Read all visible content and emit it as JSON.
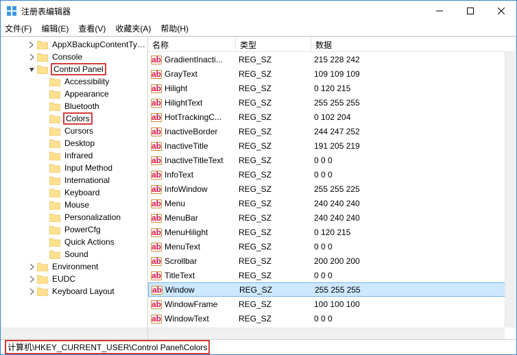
{
  "window": {
    "title": "注册表编辑器"
  },
  "menu": {
    "file": "文件(F)",
    "edit": "编辑(E)",
    "view": "查看(V)",
    "fav": "收藏夹(A)",
    "help": "帮助(H)"
  },
  "tree": [
    {
      "indent": 36,
      "tw": "r",
      "label": "AppXBackupContentType"
    },
    {
      "indent": 36,
      "tw": "r",
      "label": "Console"
    },
    {
      "indent": 36,
      "tw": "d",
      "label": "Control Panel",
      "hl": true,
      "chev": true
    },
    {
      "indent": 54,
      "tw": "",
      "label": "Accessibility"
    },
    {
      "indent": 54,
      "tw": "",
      "label": "Appearance"
    },
    {
      "indent": 54,
      "tw": "",
      "label": "Bluetooth"
    },
    {
      "indent": 54,
      "tw": "",
      "label": "Colors",
      "hl": true
    },
    {
      "indent": 54,
      "tw": "",
      "label": "Cursors"
    },
    {
      "indent": 54,
      "tw": "",
      "label": "Desktop"
    },
    {
      "indent": 54,
      "tw": "",
      "label": "Infrared"
    },
    {
      "indent": 54,
      "tw": "",
      "label": "Input Method"
    },
    {
      "indent": 54,
      "tw": "",
      "label": "International"
    },
    {
      "indent": 54,
      "tw": "",
      "label": "Keyboard"
    },
    {
      "indent": 54,
      "tw": "",
      "label": "Mouse"
    },
    {
      "indent": 54,
      "tw": "",
      "label": "Personalization"
    },
    {
      "indent": 54,
      "tw": "",
      "label": "PowerCfg"
    },
    {
      "indent": 54,
      "tw": "",
      "label": "Quick Actions"
    },
    {
      "indent": 54,
      "tw": "",
      "label": "Sound"
    },
    {
      "indent": 36,
      "tw": "r",
      "label": "Environment"
    },
    {
      "indent": 36,
      "tw": "r",
      "label": "EUDC"
    },
    {
      "indent": 36,
      "tw": "r",
      "label": "Keyboard Layout"
    }
  ],
  "columns": {
    "name": "名称",
    "type": "类型",
    "data": "数据"
  },
  "rows": [
    {
      "name": "GradientInacti...",
      "type": "REG_SZ",
      "data": "215 228 242"
    },
    {
      "name": "GrayText",
      "type": "REG_SZ",
      "data": "109 109 109"
    },
    {
      "name": "Hilight",
      "type": "REG_SZ",
      "data": "0 120 215"
    },
    {
      "name": "HilightText",
      "type": "REG_SZ",
      "data": "255 255 255"
    },
    {
      "name": "HotTrackingC...",
      "type": "REG_SZ",
      "data": "0 102 204"
    },
    {
      "name": "InactiveBorder",
      "type": "REG_SZ",
      "data": "244 247 252"
    },
    {
      "name": "InactiveTitle",
      "type": "REG_SZ",
      "data": "191 205 219"
    },
    {
      "name": "InactiveTitleText",
      "type": "REG_SZ",
      "data": "0 0 0"
    },
    {
      "name": "InfoText",
      "type": "REG_SZ",
      "data": "0 0 0"
    },
    {
      "name": "InfoWindow",
      "type": "REG_SZ",
      "data": "255 255 225"
    },
    {
      "name": "Menu",
      "type": "REG_SZ",
      "data": "240 240 240"
    },
    {
      "name": "MenuBar",
      "type": "REG_SZ",
      "data": "240 240 240"
    },
    {
      "name": "MenuHilight",
      "type": "REG_SZ",
      "data": "0 120 215"
    },
    {
      "name": "MenuText",
      "type": "REG_SZ",
      "data": "0 0 0"
    },
    {
      "name": "Scrollbar",
      "type": "REG_SZ",
      "data": "200 200 200"
    },
    {
      "name": "TitleText",
      "type": "REG_SZ",
      "data": "0 0 0"
    },
    {
      "name": "Window",
      "type": "REG_SZ",
      "data": "255 255 255",
      "selected": true
    },
    {
      "name": "WindowFrame",
      "type": "REG_SZ",
      "data": "100 100 100"
    },
    {
      "name": "WindowText",
      "type": "REG_SZ",
      "data": "0 0 0"
    }
  ],
  "status": {
    "path": "计算机\\HKEY_CURRENT_USER\\Control Panel\\Colors"
  }
}
